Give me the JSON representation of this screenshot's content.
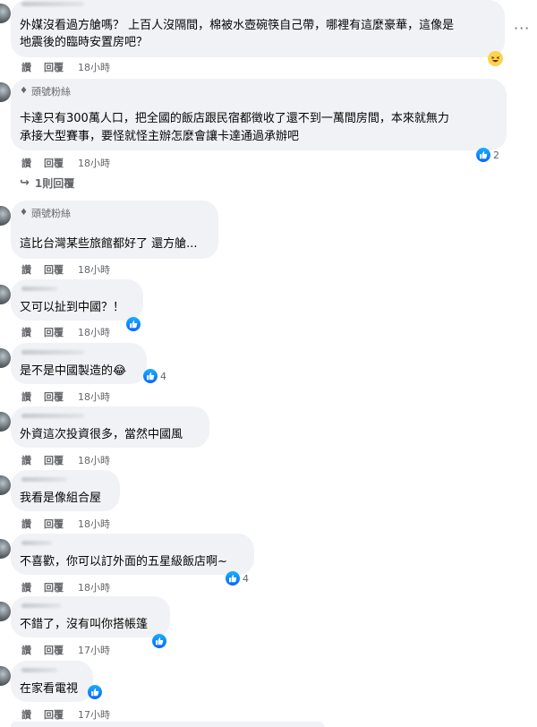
{
  "actions": {
    "like": "讚",
    "reply": "回覆"
  },
  "more_label": "···",
  "view_replies": {
    "arrow": "↪",
    "label": "1則回覆"
  },
  "comments": [
    {
      "badge": "",
      "lines": [
        "外媒沒看過方艙嗎？ 上百人沒隔間，棉被水壺碗筷自己帶，哪裡有這麼豪華，這像是",
        "地震後的臨時安置房吧？"
      ],
      "time": "18小時",
      "reactions": [
        "haha"
      ],
      "reaction_count": ""
    },
    {
      "badge": "頭號粉絲",
      "lines": [
        "卡達只有300萬人口，把全國的飯店跟民宿都徵收了還不到一萬間房間，本來就無力",
        "承接大型賽事，要怪就怪主辦怎麼會讓卡達通過承辦吧"
      ],
      "time": "18小時",
      "reactions": [
        "like"
      ],
      "reaction_count": "2"
    },
    {
      "badge": "頭號粉絲",
      "lines": [
        "這比台灣某些旅館都好了 還方艙..."
      ],
      "time": "18小時",
      "reactions": [],
      "reaction_count": ""
    },
    {
      "badge": "",
      "lines": [
        "又可以扯到中國？！"
      ],
      "time": "18小時",
      "reactions": [
        "like"
      ],
      "reaction_count": ""
    },
    {
      "badge": "",
      "lines": [
        "是不是中國製造的😂"
      ],
      "time": "18小時",
      "reactions": [
        "like"
      ],
      "reaction_count": "4"
    },
    {
      "badge": "",
      "lines": [
        "外資這次投資很多，當然中國風"
      ],
      "time": "18小時",
      "reactions": [],
      "reaction_count": ""
    },
    {
      "badge": "",
      "lines": [
        "我看是像組合屋"
      ],
      "time": "18小時",
      "reactions": [],
      "reaction_count": ""
    },
    {
      "badge": "",
      "lines": [
        "不喜歡，你可以訂外面的五星級飯店啊~"
      ],
      "time": "18小時",
      "reactions": [
        "like"
      ],
      "reaction_count": "4"
    },
    {
      "badge": "",
      "lines": [
        "不錯了，沒有叫你搭帳篷"
      ],
      "time": "17小時",
      "reactions": [
        "like"
      ],
      "reaction_count": ""
    },
    {
      "badge": "",
      "lines": [
        "在家看電視"
      ],
      "time": "17小時",
      "reactions": [
        "like"
      ],
      "reaction_count": ""
    }
  ],
  "colors": {
    "bubble": "#f0f2f5",
    "text": "#050505",
    "meta": "#65676b",
    "like": "#0866ff",
    "haha": "#fcd34d"
  }
}
